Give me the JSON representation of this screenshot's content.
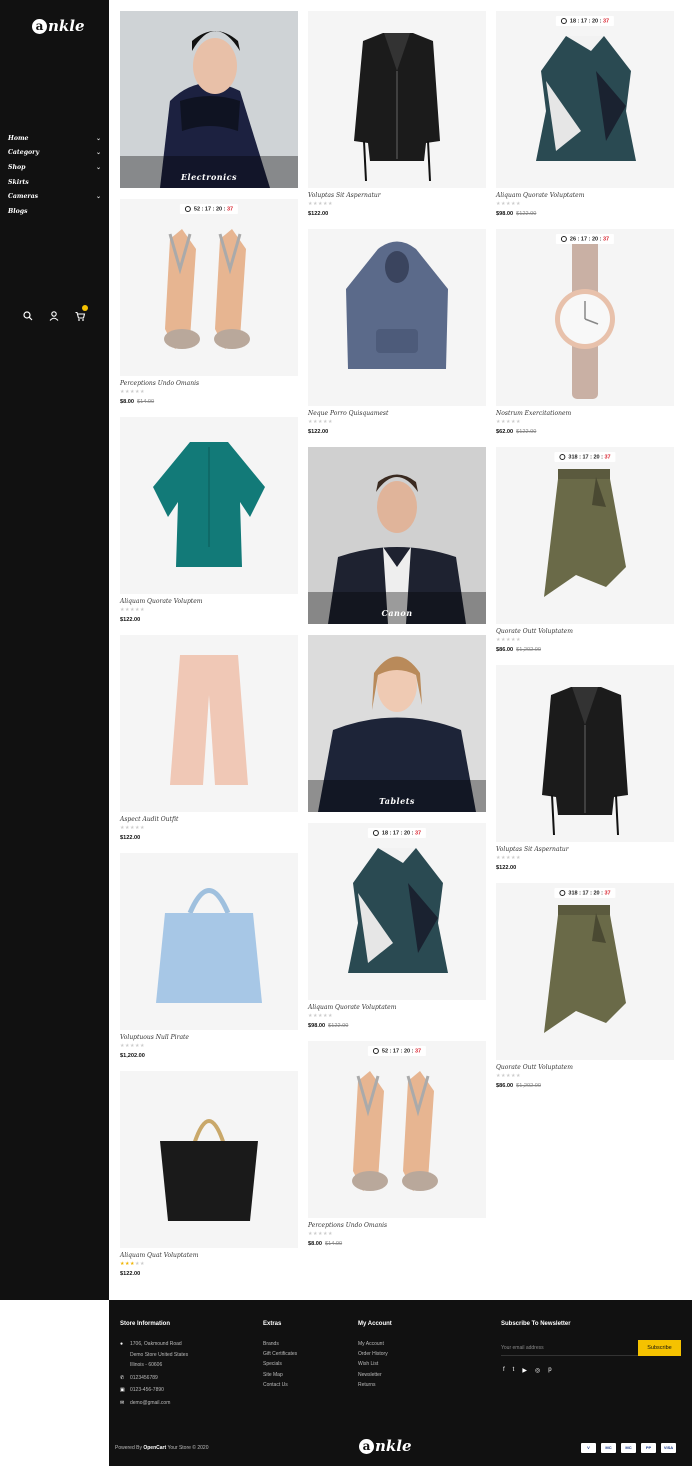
{
  "brand": {
    "logo_letter": "a",
    "logo_rest": "nkle"
  },
  "nav": {
    "items": [
      {
        "label": "Home",
        "chev": "⌄"
      },
      {
        "label": "Category",
        "chev": "⌄"
      },
      {
        "label": "Shop",
        "chev": "⌄"
      },
      {
        "label": "Skirts",
        "chev": ""
      },
      {
        "label": "Cameras",
        "chev": "⌄"
      },
      {
        "label": "Blogs",
        "chev": ""
      }
    ]
  },
  "sidebar_icons": [
    "search-icon",
    "user-icon",
    "cart-icon"
  ],
  "col1": [
    {
      "banner": "Electronics"
    },
    {
      "timer": {
        "d": "52",
        "h": "17",
        "m": "20",
        "s": "37"
      },
      "name": "Perceptions Undo Omanis",
      "stars": 0,
      "price": "$8.00",
      "old": "$14.00"
    },
    {
      "name": "Aliquam Quorate Voluptem",
      "stars": 0,
      "price": "$122.00",
      "old": ""
    },
    {
      "name": "Aspect Audit Outfit",
      "stars": 0,
      "price": "$122.00",
      "old": ""
    },
    {
      "name": "Voluptuous Null Pirate",
      "stars": 0,
      "price": "$1,202.00",
      "old": ""
    },
    {
      "name": "Aliquam Quat Voluptatem",
      "stars": 3,
      "price": "$122.00",
      "old": ""
    }
  ],
  "col2": [
    {
      "name": "Voluptas Sit Aspernatur",
      "stars": 0,
      "price": "$122.00",
      "old": ""
    },
    {
      "name": "Neque Porro Quisquamest",
      "stars": 0,
      "price": "$122.00",
      "old": ""
    },
    {
      "banner": "Canon"
    },
    {
      "banner": "Tablets"
    },
    {
      "timer": {
        "d": "18",
        "h": "17",
        "m": "20",
        "s": "37"
      },
      "name": "Aliquam Quorate Voluptatem",
      "stars": 0,
      "price": "$98.00",
      "old": "$122.00"
    },
    {
      "timer": {
        "d": "52",
        "h": "17",
        "m": "20",
        "s": "37"
      },
      "name": "Perceptions Undo Omanis",
      "stars": 0,
      "price": "$8.00",
      "old": "$14.00"
    }
  ],
  "col3": [
    {
      "timer": {
        "d": "18",
        "h": "17",
        "m": "20",
        "s": "37"
      },
      "name": "Aliquam Quorate Voluptatem",
      "stars": 0,
      "price": "$98.00",
      "old": "$122.00"
    },
    {
      "timer": {
        "d": "26",
        "h": "17",
        "m": "20",
        "s": "37"
      },
      "name": "Nostrum Exercitationem",
      "stars": 0,
      "price": "$62.00",
      "old": "$122.00"
    },
    {
      "timer": {
        "d": "318",
        "h": "17",
        "m": "20",
        "s": "37"
      },
      "name": "Quorate Outt Voluptatem",
      "stars": 0,
      "price": "$86.00",
      "old": "$1,202.00"
    },
    {
      "name": "Voluptas Sit Aspernatur",
      "stars": 0,
      "price": "$122.00",
      "old": ""
    },
    {
      "timer": {
        "d": "318",
        "h": "17",
        "m": "20",
        "s": "37"
      },
      "name": "Quorate Outt Voluptatem",
      "stars": 0,
      "price": "$86.00",
      "old": "$1,202.00"
    }
  ],
  "footer": {
    "store": {
      "title": "Store Information",
      "address": [
        "1706, Oakmound Road",
        "Demo Store United States",
        "Illinois - 60606"
      ],
      "phone": "0123456789",
      "fax": "0123-456-7890",
      "email": "demo@gmail.com"
    },
    "extras": {
      "title": "Extras",
      "links": [
        "Brands",
        "Gift Certificates",
        "Specials",
        "Site Map",
        "Contact Us"
      ]
    },
    "account": {
      "title": "My Account",
      "links": [
        "My Account",
        "Order History",
        "Wish List",
        "Newsletter",
        "Returns"
      ]
    },
    "newsletter": {
      "title": "Subscribe To Newsletter",
      "placeholder": "Your email address",
      "button": "Subscribe"
    },
    "social": [
      "f",
      "t",
      "▶",
      "◎",
      "p"
    ],
    "powered_prefix": "Powered By",
    "powered_brand": "OpenCart",
    "powered_suffix": "Your Store © 2020",
    "payments": [
      "V",
      "MC",
      "MC",
      "PP",
      "VISA"
    ]
  }
}
